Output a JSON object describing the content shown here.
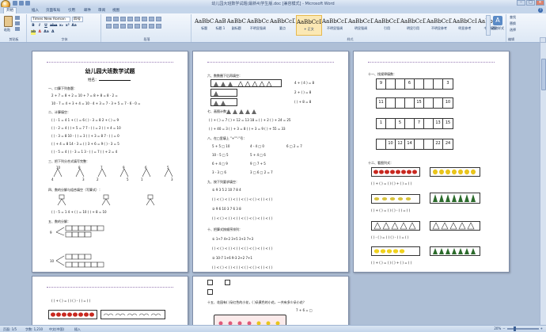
{
  "window": {
    "title": "幼儿园大班数学试题(最新4)学生版.doc [兼容模式] - Microsoft Word",
    "controls": [
      "–",
      "□",
      "×"
    ]
  },
  "tabs": [
    "开始",
    "插入",
    "页面布局",
    "引用",
    "邮件",
    "审阅",
    "视图"
  ],
  "ribbon": {
    "paste_label": "粘贴",
    "font_name": "Times New Roman",
    "font_size": "四号",
    "format_row1": [
      "B",
      "I",
      "U",
      "abe",
      "x₂",
      "x²",
      "Aa"
    ],
    "format_row2": [
      "ab",
      "A",
      "Aa",
      "A"
    ],
    "groups": [
      "剪贴板",
      "字体",
      "段落",
      "样式",
      "编辑"
    ],
    "styles": [
      {
        "sample": "AaBbC",
        "name": "标题"
      },
      {
        "sample": "AaB",
        "name": "标题 1"
      },
      {
        "sample": "AaBbC",
        "name": "副标题"
      },
      {
        "sample": "AaBbCc",
        "name": "不明显强调"
      },
      {
        "sample": "AaBbCcD",
        "name": "要点"
      },
      {
        "sample": "AaBbCcD",
        "name": "+ 正文"
      },
      {
        "sample": "AaBbCcD",
        "name": "不明显强调"
      },
      {
        "sample": "AaBbCcD",
        "name": "明显强调"
      },
      {
        "sample": "AaBbCcD",
        "name": "引用"
      },
      {
        "sample": "AaBbCcD",
        "name": "明显引用"
      },
      {
        "sample": "AaBbCcD",
        "name": "不明显参考"
      },
      {
        "sample": "AaBbCcI",
        "name": "明显参考"
      },
      {
        "sample": "AaBbCcI",
        "name": "书籍标题"
      }
    ],
    "change_styles": "更改样式",
    "edit_items": [
      "查找",
      "替换",
      "选择"
    ]
  },
  "doc": {
    "page1": {
      "title": "幼儿园大班数学试题",
      "name_line": "姓名：",
      "lines": [
        "一、口算下列各题：",
        "2 + 7 =        8 + 2 =        10 + 7 =        8 + 8 =        8 - 2 =",
        "10 - 7 =       4 + 3 + 4 =    10 - 4 + 3 =    7 - 3 + 5 =    7 - 6 - 0 =",
        "二、计算填空：",
        "( ) - 1 = 4     1 + ( ) = 6     ( ) - 3 = 8     2 + ( ) = 9",
        "( ) - 2 = 4     ( ) + 5 = 7     7 - ( ) = 2     ( ) + 4 = 10",
        "( ) - 3 = 8     10 - ( ) = 3     ( ) + 3 = 8     7 - ( ) = 0",
        "( ) + 4 = 8     14 - 3 = ( )     3 + 6 = 9     ( ) - 3 = 5",
        "( ) - 5 = 4     ( ) - 3 = 1     3 - ( ) = 7     ( ) + 2 = 4",
        "三、把下列分合式填写完整：",
        "四、数的分解与组合填空（写算式）：",
        "( ) - 5 = 1          4 + ( ) = 10          ( ) + 8 = 10",
        "五、数的分解："
      ]
    },
    "page2": {
      "lines": [
        "六、数数圈下后再填空：",
        "七、画图计数：",
        "( ) + ( ) = 7       ( ) + 12 = 13       18 = ( ) + 2       ( ) + 24 = 25",
        "( ) + 40 = 3        ( ) + 3 = 8         ( ) + 3 = 9        ( ) + 55 = 33",
        "八、在□里填上 \"+\"\"-\"号：",
        "九、按下列要求填空：",
        "①  9    3    5    2    10    7    8    4",
        "(  ) < (  ) < (  ) < (  ) < (  ) < (  ) < (  ) < (  )",
        "②  9    6    10    3    7    6    3    8",
        "十、把算式按顺序排列：",
        "①   1+7     4+2     3+5     3+3     7+3",
        "②   10-7    1+6     9-3     2+2     7+1"
      ],
      "box_equations": [
        "4 + ( 4 ) = 8",
        "2 + ( ) = 8",
        "( ) + 8 = 8",
        "5 + 5 □ 10",
        "10 - 5 □ 5",
        "6 □ 2 = 7",
        "6 + 4 □ 9",
        "3 - 3 □ 6",
        "9 □ 7 + 5",
        "4 - 4 □ 0",
        "5 + 4 □ 6",
        "3 □ 6 □ 2 = 7"
      ]
    },
    "page3": {
      "lines": [
        "十一、找规律填数：",
        "十二、看图列式："
      ],
      "grids": [
        [
          "9",
          "",
          "",
          "6",
          "",
          "",
          "",
          "3"
        ],
        [
          "11",
          "",
          "",
          "",
          "15",
          "",
          "",
          "10"
        ],
        [
          "1",
          "",
          "5",
          "",
          "7",
          "",
          "13",
          "15"
        ],
        [
          "",
          "10",
          "12",
          "14",
          "",
          "",
          "22",
          "24"
        ]
      ],
      "formula_lines": [
        "( ) + ( ) = ( )      ( ) + ( ) = ( )",
        "( ) + ( ) = ( )      ( ) - ( ) = ( )",
        "( ) - ( ) = ( )      ( ) - ( ) = ( )",
        "( ) + ( ) = ( )      ( ) + ( ) = ( )"
      ]
    },
    "page4": {
      "lines": [
        "( ) + ( ) = ( )          ( ) - ( ) = ( )"
      ]
    },
    "page5": {
      "lines": [
        "十五、花园有( )朵红色的小花，( )朵黄色的小花，一共有多少朵小花？"
      ],
      "eq": "7 + 6 = □"
    }
  },
  "status": {
    "page": "页面: 1/5",
    "words": "字数: 1,210",
    "lang": "中文(中国)",
    "mode": "插入",
    "zoom": "20%"
  }
}
